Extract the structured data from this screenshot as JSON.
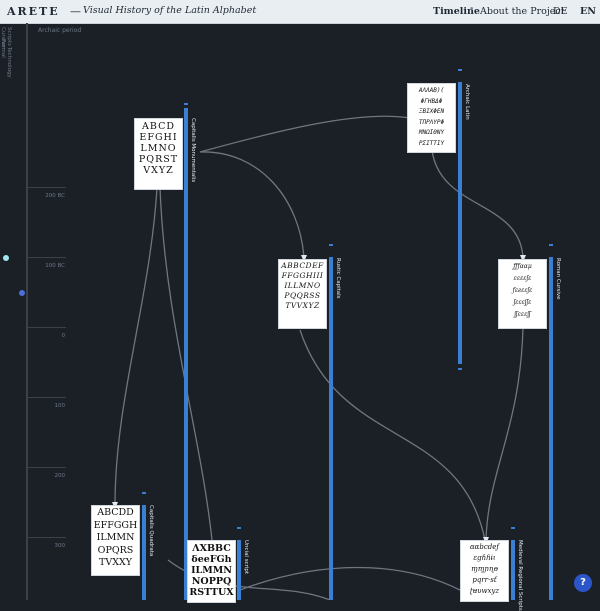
{
  "header": {
    "brand": "ARETE",
    "dash": "—",
    "subtitle": "Visual History of the Latin Alphabet",
    "nav": {
      "timeline": "Timeline",
      "separator": "•",
      "about": "About the Project"
    },
    "languages": {
      "de": "DE",
      "en": "EN"
    }
  },
  "sidebar": {
    "labels": [
      "Cursive",
      "Formal",
      "Scripts",
      "Technology"
    ]
  },
  "timeline": {
    "period_label": "Archaic period",
    "ticks": [
      "200 BC",
      "100 BC",
      "0",
      "100",
      "200",
      "300"
    ]
  },
  "scripts": [
    {
      "id": "capitalis-monumentalis",
      "name": "Capitalis Monumentalis",
      "sample": [
        "ABCD",
        "EFGHI",
        "LMNO",
        "PQRST",
        "VXYZ"
      ]
    },
    {
      "id": "archaic-latin",
      "name": "Archaic Latin",
      "sample": [
        "ΑΛΛΑΒ)(",
        "ΦΓΗΒΔΦ",
        "ΞΒΙΧΦΕΝ",
        "ΤΠΡΛΥΡΦ",
        "ΜΝΩΙΘΝΥ",
        "ΡΣΙΤΤΙΥ"
      ]
    },
    {
      "id": "rustic-capitals",
      "name": "Rustic Capitals",
      "sample": [
        "ABBCDEF",
        "FFGGHIII",
        "ILLMNO",
        "PQQRSS",
        "TVVXYZ"
      ]
    },
    {
      "id": "roman-cursive",
      "name": "Roman Cursive",
      "sample": [
        "ƒƒƒααμ",
        "ɛɛɛɛʃɛ",
        "ƒɛƨɛɛʃɛ",
        "ʃɛɛɛʃʃɛ",
        "ʃʃɛɛɛʃʃ"
      ]
    },
    {
      "id": "capitalis-quadrata",
      "name": "Capitalis Quadrata",
      "sample": [
        "ABCDD",
        "EFFGGH",
        "ILMMN",
        "OPQRS",
        "TVXXY"
      ]
    },
    {
      "id": "uncial-script",
      "name": "Uncial script",
      "sample": [
        "ΛXBBC",
        "δeeFGh",
        "ILMMN",
        "NOPPQ",
        "RSTTUX"
      ]
    },
    {
      "id": "medieval-regional-scripts",
      "name": "Medieval Regional Scripts",
      "sample": [
        "ɑɑbcdeƒ",
        "ɛɡɦɦɨɩ",
        "ɱɱɲɳɵ",
        "pqrr·sƭ",
        "ʈʉʋwxyz"
      ]
    }
  ],
  "help": {
    "label": "?"
  },
  "colors": {
    "accent": "#3b7fd3",
    "background": "#1b1f26",
    "header": "#e9eef3"
  }
}
